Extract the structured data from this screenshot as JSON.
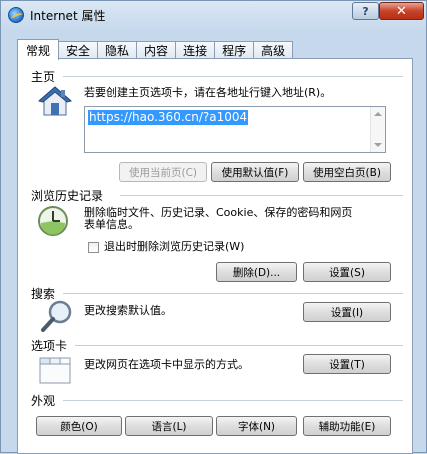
{
  "window": {
    "title": "Internet 属性",
    "help_label": "?",
    "close_label": "✕"
  },
  "tabs": [
    {
      "label": "常规",
      "active": true
    },
    {
      "label": "安全"
    },
    {
      "label": "隐私"
    },
    {
      "label": "内容"
    },
    {
      "label": "连接"
    },
    {
      "label": "程序"
    },
    {
      "label": "高级"
    }
  ],
  "homepage": {
    "title": "主页",
    "description": "若要创建主页选项卡，请在各地址行键入地址(R)。",
    "url": "https://hao.360.cn/?a1004",
    "buttons": {
      "use_current": "使用当前页(C)",
      "use_default": "使用默认值(F)",
      "use_blank": "使用空白页(B)"
    }
  },
  "history": {
    "title": "浏览历史记录",
    "description_line1": "删除临时文件、历史记录、Cookie、保存的密码和网页",
    "description_line2": "表单信息。",
    "checkbox_label": "退出时删除浏览历史记录(W)",
    "checkbox_checked": false,
    "delete_button": "删除(D)...",
    "settings_button": "设置(S)"
  },
  "search": {
    "title": "搜索",
    "description": "更改搜索默认值。",
    "settings_button": "设置(I)"
  },
  "tabs_section": {
    "title": "选项卡",
    "description": "更改网页在选项卡中显示的方式。",
    "settings_button": "设置(T)"
  },
  "appearance": {
    "title": "外观",
    "colors_button": "颜色(O)",
    "languages_button": "语言(L)",
    "fonts_button": "字体(N)",
    "accessibility_button": "辅助功能(E)"
  },
  "icons": {
    "app": "internet-explorer-icon",
    "homepage": "house-icon",
    "history": "clock-icon",
    "search": "magnifier-icon",
    "tabs": "tabbed-window-icon"
  },
  "colors": {
    "selection": "#3399ff",
    "close_button": "#c7432a"
  }
}
